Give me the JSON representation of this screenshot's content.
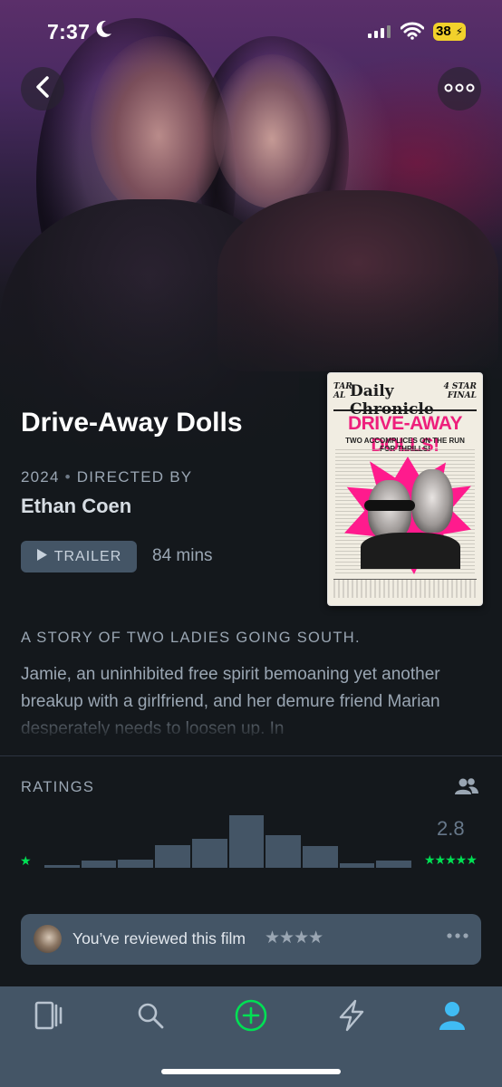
{
  "status_bar": {
    "time": "7:37",
    "battery": "38"
  },
  "film": {
    "title": "Drive-Away Dolls",
    "year": "2024",
    "directed_by_label": "DIRECTED BY",
    "director": "Ethan Coen",
    "trailer_label": "TRAILER",
    "runtime": "84 mins",
    "tagline": "A STORY OF TWO LADIES GOING SOUTH.",
    "synopsis": "Jamie, an uninhibited free spirit bemoaning yet another breakup with a girlfriend, and her demure friend Marian desperately needs to loosen up. In"
  },
  "poster": {
    "paper_name": "Daily Chronicle",
    "left_corner": "TAR\nAL",
    "right_corner": "4 STAR\nFINAL",
    "headline": "DRIVE-AWAY DOLLS!",
    "subhead": "TWO ACCOMPLICES ON THE RUN FOR THRILLS!"
  },
  "ratings": {
    "label": "RATINGS",
    "average": "2.8",
    "histogram": [
      0.05,
      0.13,
      0.15,
      0.43,
      0.55,
      1.0,
      0.62,
      0.42,
      0.08,
      0.13
    ],
    "low_star": "★",
    "high_stars": "★★★★★"
  },
  "review": {
    "text": "You’ve reviewed this film",
    "stars": "★★★★"
  },
  "icons": {
    "back": "chevron-left-icon",
    "more": "more-horizontal-icon",
    "users": "users-icon",
    "tabs": [
      "films-icon",
      "search-icon",
      "add-icon",
      "activity-icon",
      "profile-icon"
    ]
  },
  "colors": {
    "accent_green": "#00e054",
    "bar": "#445566",
    "bg": "#14181c",
    "muted": "#9aa6b3",
    "profile_blue": "#40bcf4"
  }
}
